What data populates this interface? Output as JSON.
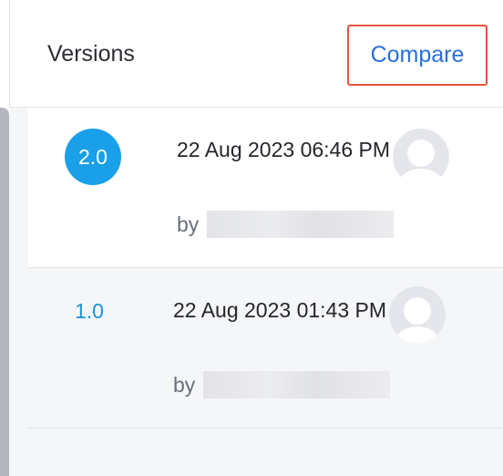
{
  "header": {
    "title": "Versions",
    "compare_label": "Compare"
  },
  "versions": [
    {
      "number": "2.0",
      "timestamp": "22 Aug 2023 06:46 PM",
      "by_label": "by",
      "selected": true
    },
    {
      "number": "1.0",
      "timestamp": "22 Aug 2023 01:43 PM",
      "by_label": "by",
      "selected": false
    }
  ],
  "colors": {
    "accent_blue": "#1aa0e8",
    "link_blue": "#2a6fdb",
    "highlight_border": "#e5553c"
  },
  "icons": {
    "avatar": "user-avatar-icon"
  }
}
